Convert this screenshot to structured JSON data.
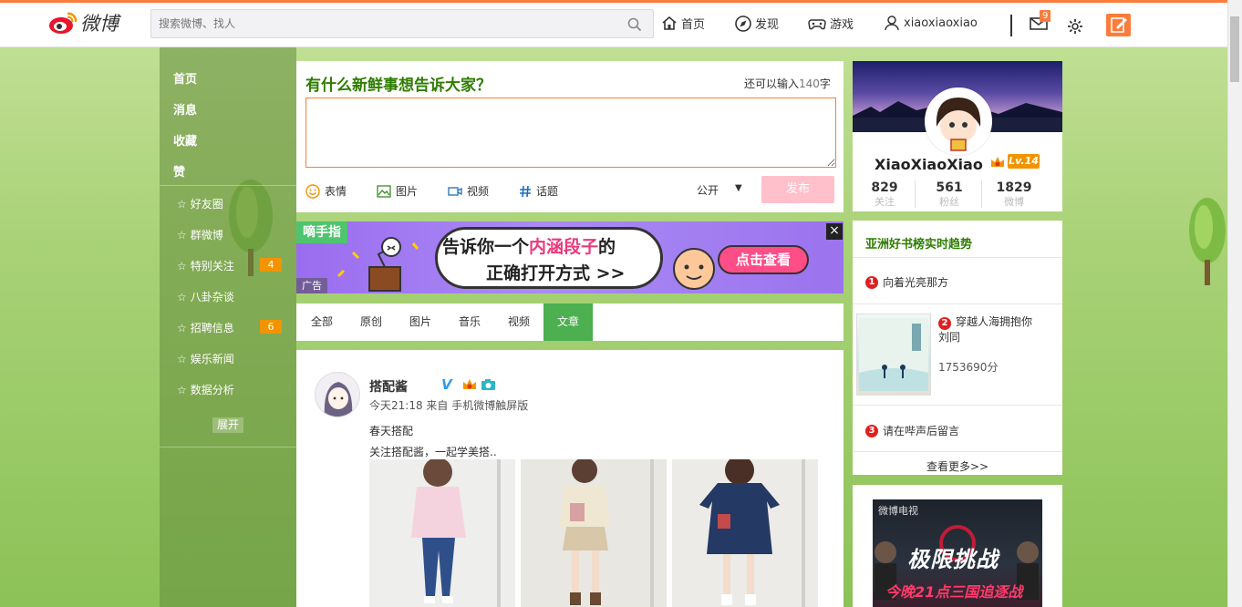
{
  "header": {
    "logo_text": "微博",
    "search_placeholder": "搜索微博、找人",
    "nav": {
      "home": "首页",
      "discover": "发现",
      "games": "游戏",
      "username": "xiaoxiaoxiao"
    },
    "message_badge": "9",
    "accent_color": "#fa7d3c"
  },
  "sidebar": {
    "main_items": [
      "首页",
      "消息",
      "收藏",
      "赞"
    ],
    "groups": [
      {
        "label": "好友圈",
        "count": ""
      },
      {
        "label": "群微博",
        "count": ""
      },
      {
        "label": "特别关注",
        "count": "4"
      },
      {
        "label": "八卦杂谈",
        "count": ""
      },
      {
        "label": "招聘信息",
        "count": "6"
      },
      {
        "label": "娱乐新闻",
        "count": ""
      },
      {
        "label": "数据分析",
        "count": ""
      }
    ],
    "expand_label": "展开"
  },
  "publisher": {
    "title": "有什么新鲜事想告诉大家？",
    "remaining_prefix": "还可以输入",
    "remaining_count": "140",
    "remaining_suffix": "字",
    "tools": [
      "表情",
      "图片",
      "视频",
      "话题"
    ],
    "visibility": "公开",
    "submit_label": "发布"
  },
  "banner": {
    "logo": "嘀手指",
    "line1_a": "告诉你一个",
    "line1_hi": "内涵段子",
    "line1_b": "的",
    "line2": "正确打开方式 >>",
    "button": "点击查看",
    "ad_tag": "广告",
    "close": "×"
  },
  "feed_tabs": {
    "items": [
      "全部",
      "原创",
      "图片",
      "音乐",
      "视频",
      "文章"
    ],
    "active": "文章",
    "active_color": "#4caf50"
  },
  "post": {
    "author": "搭配酱",
    "verified_badge": "V",
    "time_source": "今天21:18 来自 手机微博触屏版",
    "line1": "春天搭配",
    "line2": "关注搭配酱，一起学美搭.."
  },
  "profile": {
    "name": "XiaoXiaoXiao",
    "level": "Lv.14",
    "stats": [
      {
        "value": "829",
        "label": "关注"
      },
      {
        "value": "561",
        "label": "粉丝"
      },
      {
        "value": "1829",
        "label": "微博"
      }
    ]
  },
  "trending": {
    "title": "亚洲好书榜实时趋势",
    "items": [
      {
        "rank": "1",
        "title": "向着光亮那方"
      },
      {
        "rank": "2",
        "title": "穿越人海拥抱你",
        "author": "刘同",
        "score": "1753690分"
      },
      {
        "rank": "3",
        "title": "请在哔声后留言"
      }
    ],
    "more": "查看更多>>"
  },
  "tv_card": {
    "brand": "微博电视",
    "title": "极限挑战",
    "footer": "今晚21点三国追逐战"
  }
}
